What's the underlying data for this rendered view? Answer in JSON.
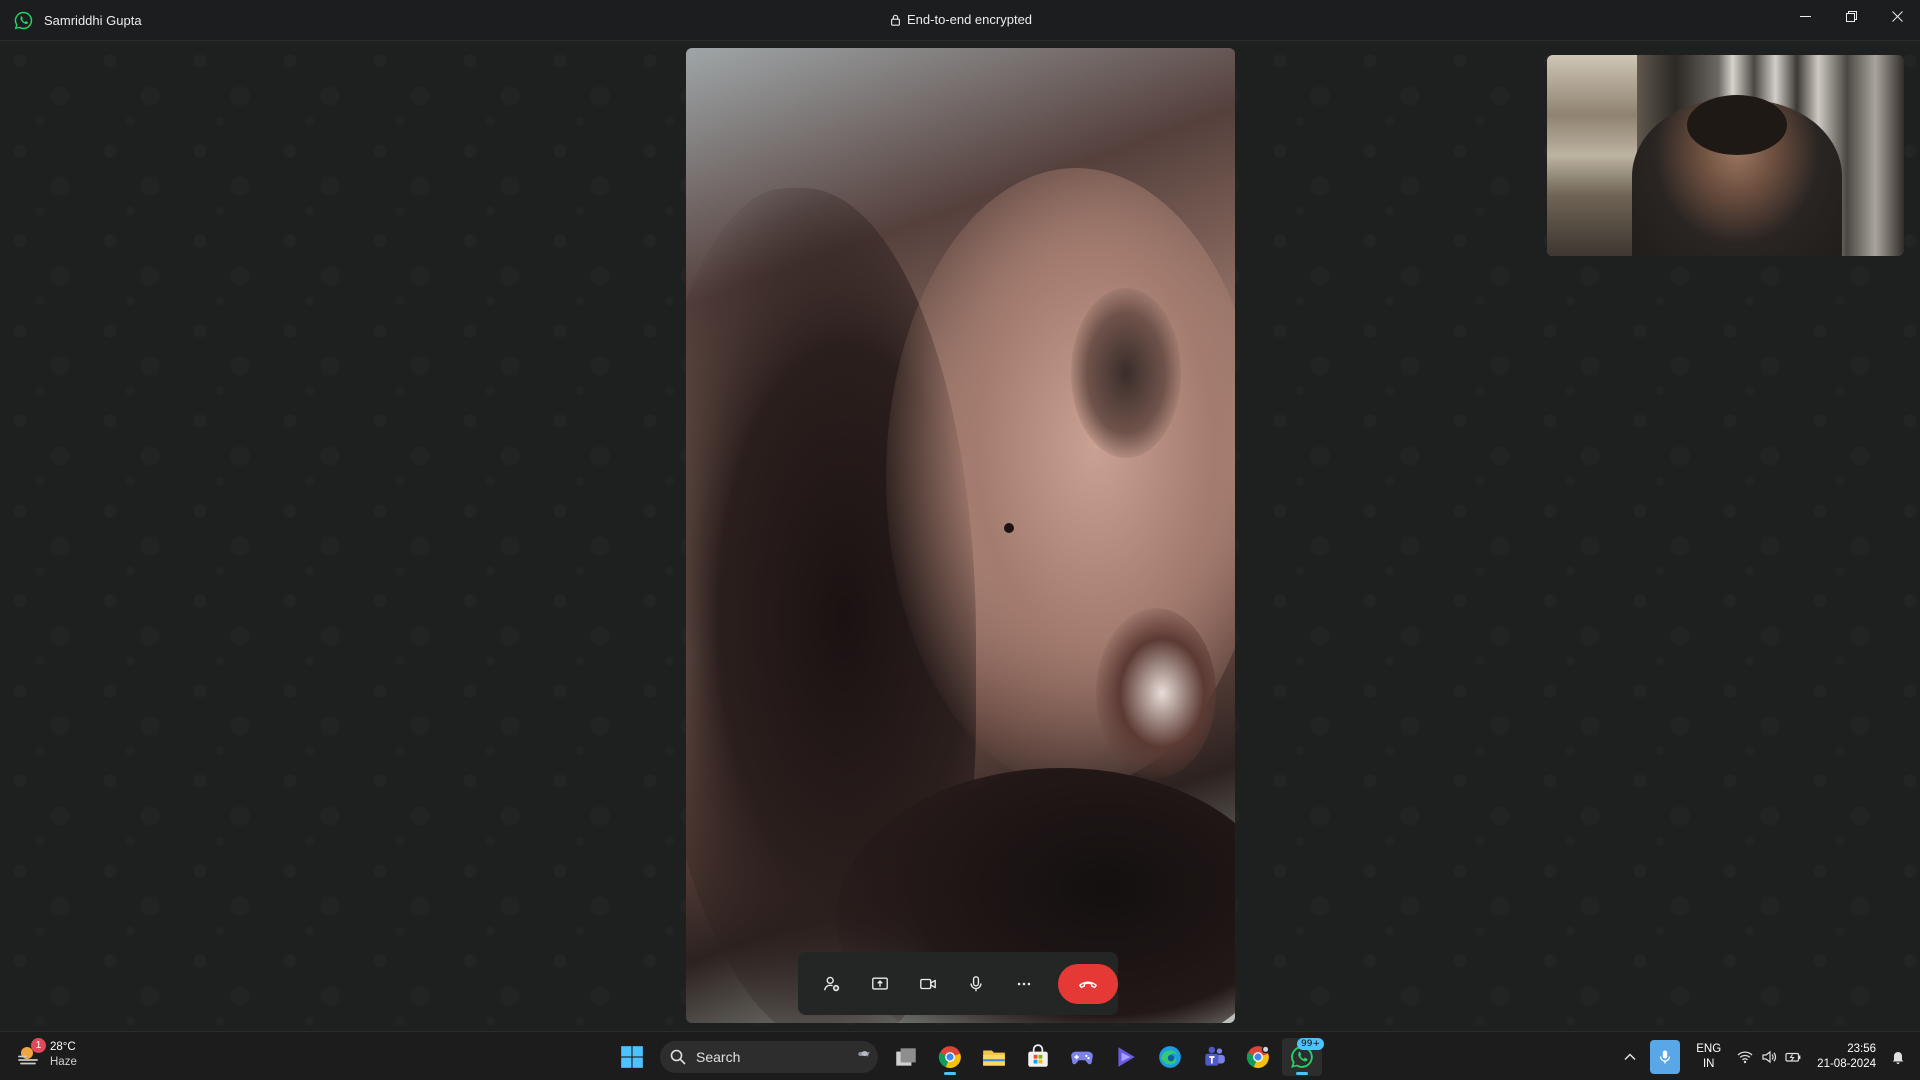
{
  "window": {
    "contact_name": "Samriddhi Gupta",
    "encryption_label": "End-to-end encrypted",
    "controls": [
      "minimize-icon",
      "restore-icon",
      "close-icon"
    ]
  },
  "call": {
    "remote_video": "remote participant video feed",
    "self_video": "self preview video feed",
    "controls": [
      {
        "name": "add-participant-button",
        "icon": "add-person-icon"
      },
      {
        "name": "share-screen-button",
        "icon": "share-screen-icon"
      },
      {
        "name": "camera-button",
        "icon": "video-camera-icon"
      },
      {
        "name": "microphone-button",
        "icon": "microphone-icon"
      },
      {
        "name": "more-options-button",
        "icon": "more-horizontal-icon"
      },
      {
        "name": "end-call-button",
        "icon": "end-call-icon",
        "color": "#e53935"
      }
    ]
  },
  "taskbar": {
    "weather": {
      "temp": "28°C",
      "condition": "Haze",
      "badge": "1"
    },
    "search_placeholder": "Search",
    "apps": [
      "windows-start-icon",
      "search",
      "task-view-icon",
      "chrome-icon",
      "file-explorer-icon",
      "microsoft-store-icon",
      "game-controller-icon",
      "media-play-icon",
      "edge-icon",
      "teams-icon",
      "chrome-profile-icon",
      "whatsapp-icon"
    ],
    "whatsapp_badge": "99+",
    "tray": {
      "language_top": "ENG",
      "language_bottom": "IN",
      "time": "23:56",
      "date": "21-08-2024"
    }
  },
  "colors": {
    "background": "#1f2121",
    "accent_blue": "#4cc2ff",
    "end_call_red": "#e53935",
    "whatsapp_green": "#25d366"
  }
}
